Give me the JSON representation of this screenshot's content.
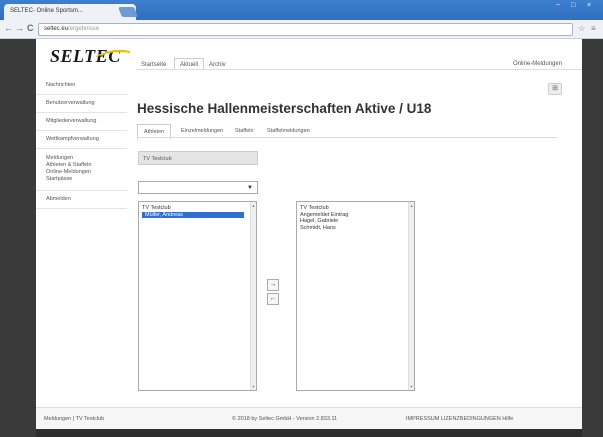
{
  "browser": {
    "tab_title": "SELTEC- Online Sportsm...",
    "tab_close": "×",
    "url_domain": "seltec.eu",
    "url_rest": "/ergebnisse",
    "back": "←",
    "forward": "→",
    "reload": "C",
    "minimize": "−",
    "maximize": "□",
    "close": "×",
    "bookmark_icon": "☆",
    "menu_icon": "≡"
  },
  "header": {
    "logo": "SELTEC",
    "top_nav": [
      "Startseite",
      "Aktuell",
      "Archiv"
    ],
    "top_nav_active": 1,
    "top_right": "Online-Meldungen"
  },
  "sidebar": {
    "items": [
      "Nachrichten",
      "Benutzerverwaltung",
      "Mitgliederverwaltung",
      "Wettkampfverwaltung"
    ],
    "group": [
      "Meldungen",
      "Athleten & Staffeln",
      "Online-Meldungen",
      "Startpässe"
    ],
    "last": "Abmelden"
  },
  "main": {
    "title": "Hessische Hallenmeisterschaften Aktive / U18",
    "title_icon": "⊞",
    "subtabs": [
      "Athleten",
      "Einzelmeldungen",
      "Staffeln",
      "Staffelmeldungen"
    ],
    "subtab_active": 0,
    "team": "TV Testclub",
    "select_arrow": "▼",
    "left_list": {
      "items": [
        "TV Testclub",
        "Müller, Andreas"
      ],
      "selected": 1
    },
    "right_list": {
      "items": [
        "TV Testclub",
        "Angemeldet Eintrag",
        "Hagel, Gabriele",
        "Schmidt, Hans"
      ]
    },
    "scroll_up": "▲",
    "scroll_down": "▼",
    "move_right": "→",
    "move_left": "←"
  },
  "footer": {
    "left": "Meldungen | TV Testclub",
    "center": "© 2018 by Seltec GmbH - Version 2.833.11",
    "right": "IMPRESSUM  LIZENZBEDINGUNGEN  Hilfe"
  },
  "colors": {
    "titlebar": "#3f7fd0",
    "selection": "#2f6fd0",
    "page_frame": "#2e2e2e"
  }
}
